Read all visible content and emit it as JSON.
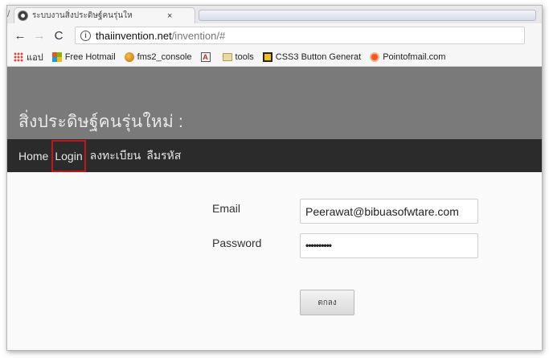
{
  "browser": {
    "tab_title": "ระบบงานสิ่งประดิษฐ์คนรุ่นให",
    "tab_close": "×",
    "back_icon": "←",
    "forward_icon": "→",
    "reload_icon": "C",
    "info_icon": "i",
    "url_host": "thaiinvention.net",
    "url_path": "/invention/#"
  },
  "bookmarks": [
    {
      "label": "แอป",
      "icon": "apps-icon"
    },
    {
      "label": "Free Hotmail",
      "icon": "ms-icon"
    },
    {
      "label": "fms2_console",
      "icon": "fms-icon"
    },
    {
      "label": "",
      "icon": "a-icon"
    },
    {
      "label": "tools",
      "icon": "folder-icon"
    },
    {
      "label": "CSS3 Button Generat",
      "icon": "css3-icon"
    },
    {
      "label": "Pointofmail.com",
      "icon": "pom-icon"
    }
  ],
  "site": {
    "title": "สิ่งประดิษฐ์คนรุ่นใหม่ :",
    "nav": [
      "Home",
      "Login",
      "ลงทะเบียน",
      "ลืมรหัส"
    ]
  },
  "form": {
    "email_label": "Email",
    "email_value": "Peerawat@bibuasofwtare.com",
    "password_label": "Password",
    "password_value": "••••••••••",
    "submit_label": "ตกลง"
  }
}
